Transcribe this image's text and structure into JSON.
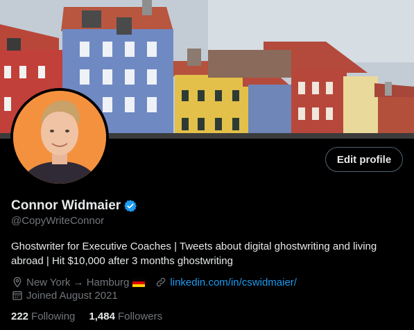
{
  "profile": {
    "display_name": "Connor Widmaier",
    "handle": "@CopyWriteConnor",
    "verified": true,
    "bio": "Ghostwriter for Executive Coaches | Tweets about digital ghostwriting and living abroad | Hit $10,000 after 3 months ghostwriting",
    "location": "New York → Hamburg",
    "website": "linkedin.com/in/cswidmaier/",
    "joined": "Joined August 2021",
    "following_count": "222",
    "following_label": "Following",
    "followers_count": "1,484",
    "followers_label": "Followers"
  },
  "actions": {
    "edit_profile_label": "Edit profile"
  },
  "colors": {
    "accent": "#1d9bf0",
    "background": "#000000",
    "text_primary": "#e7e9ea",
    "text_secondary": "#71767b",
    "avatar_bg": "#f4913f"
  },
  "icons": {
    "verified": "verified-badge-icon",
    "location": "location-pin-icon",
    "link": "link-icon",
    "calendar": "calendar-icon",
    "flag": "germany-flag-icon"
  }
}
